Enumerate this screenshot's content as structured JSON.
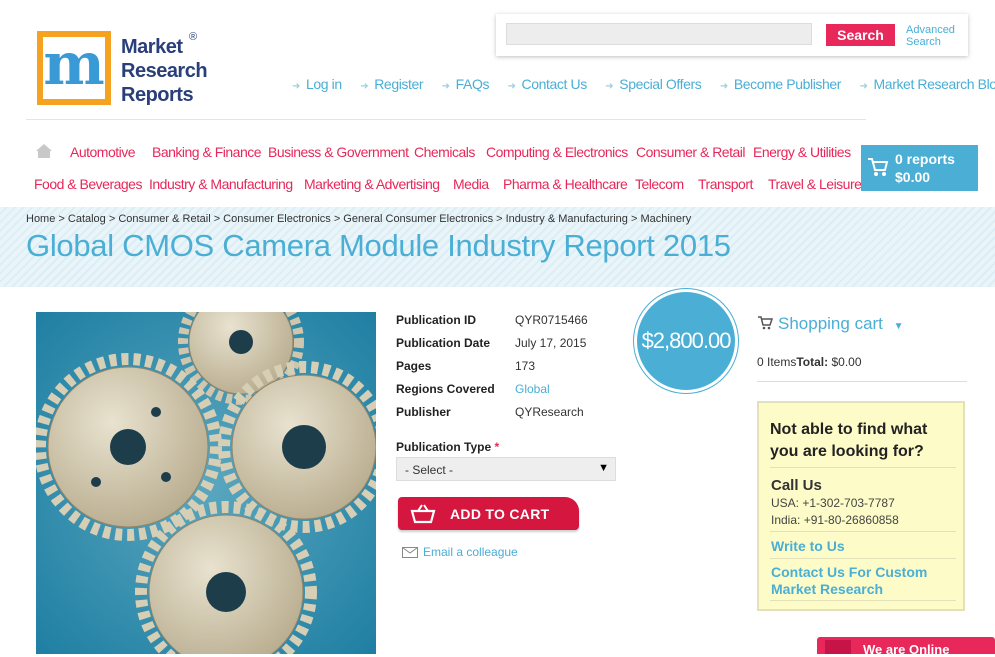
{
  "logo": {
    "letter": "m",
    "line1": "Market",
    "line2": "Research",
    "line3": "Reports",
    "registered": "®"
  },
  "search": {
    "button": "Search",
    "advanced_line1": "Advanced",
    "advanced_line2": "Search",
    "placeholder": ""
  },
  "top_links": [
    "Log in",
    "Register",
    "FAQs",
    "Contact Us",
    "Special Offers",
    "Become Publisher",
    "Market Research Blog"
  ],
  "categories_row1": [
    "Automotive",
    "Banking & Finance",
    "Business & Government",
    "Chemicals",
    "Computing & Electronics",
    "Consumer & Retail",
    "Energy & Utilities"
  ],
  "categories_row2": [
    "Food & Beverages",
    "Industry & Manufacturing",
    "Marketing & Advertising",
    "Media",
    "Pharma & Healthcare",
    "Telecom",
    "Transport",
    "Travel & Leisure"
  ],
  "cart_box": {
    "reports": "0 reports",
    "amount": "$0.00"
  },
  "breadcrumb": "Home > Catalog > Consumer & Retail > Consumer Electronics > General Consumer Electronics > Industry & Manufacturing > Machinery",
  "title": "Global CMOS Camera Module Industry Report 2015",
  "details": [
    {
      "label": "Publication ID",
      "value": "QYR0715466"
    },
    {
      "label": "Publication Date",
      "value": "July 17, 2015"
    },
    {
      "label": "Pages",
      "value": "173"
    },
    {
      "label": "Regions Covered",
      "value": "Global"
    },
    {
      "label": "Publisher",
      "value": "QYResearch"
    }
  ],
  "price": "$2,800.00",
  "publication_type": {
    "label": "Publication Type",
    "required": "*",
    "selected": "- Select -"
  },
  "add_to_cart": "ADD TO CART",
  "email_colleague": "Email a colleague",
  "shopping_cart": {
    "title": "Shopping cart",
    "items": "0 Items",
    "total_label": "Total:",
    "total": " $0.00"
  },
  "help": {
    "question_line1": "Not able to find what",
    "question_line2": "you are looking for?",
    "call_us": "Call Us",
    "usa": "USA: +1-302-703-7787",
    "india": "India: +91-80-26860858",
    "write_to_us": "Write to Us",
    "custom_line1": "Contact Us For Custom",
    "custom_line2": "Market Research"
  },
  "online": "We are Online",
  "colors": {
    "accent_blue": "#4aaed5",
    "accent_pink": "#e8275a",
    "cart_red": "#d5163f",
    "help_bg": "#fdfcc8"
  }
}
